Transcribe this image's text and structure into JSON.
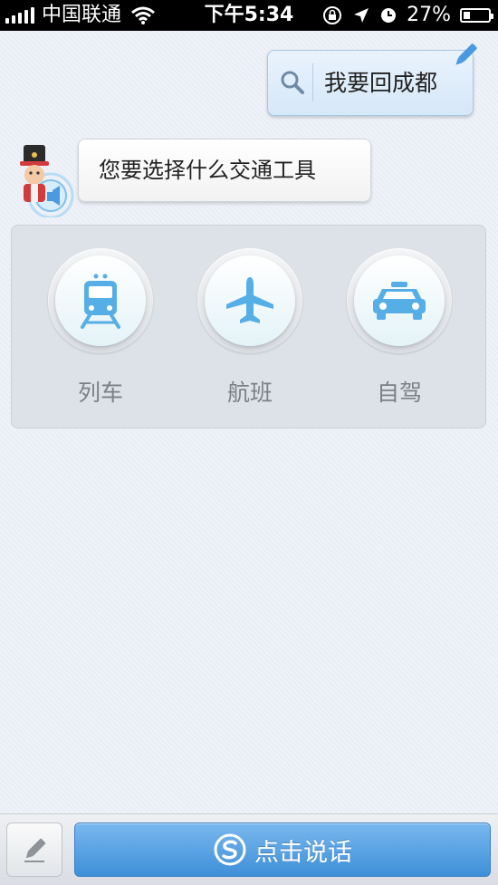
{
  "status_bar": {
    "carrier": "中国联通",
    "time": "下午5:34",
    "battery": "27%",
    "battery_level": 0.27
  },
  "conversation": {
    "user_message": "我要回成都",
    "assistant_message": "您要选择什么交通工具"
  },
  "transport_options": [
    {
      "label": "列车",
      "icon": "train-icon"
    },
    {
      "label": "航班",
      "icon": "airplane-icon"
    },
    {
      "label": "自驾",
      "icon": "car-icon"
    }
  ],
  "bottom_bar": {
    "speak_label": "点击说话",
    "edit_icon": "pencil-icon"
  },
  "colors": {
    "accent_blue": "#4a9ae0",
    "icon_blue": "#56aee6",
    "background": "#e9eef5"
  }
}
